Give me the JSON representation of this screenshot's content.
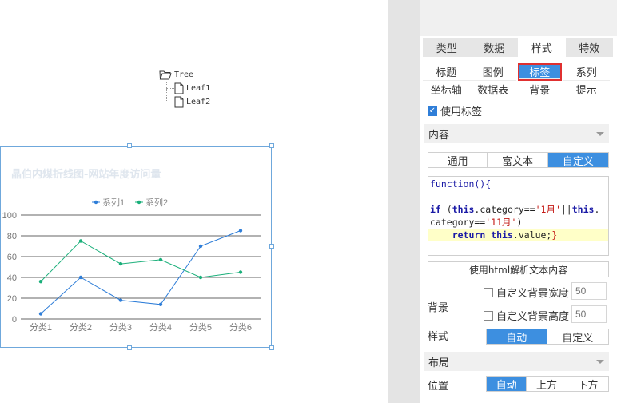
{
  "tree": {
    "root": "Tree",
    "leaves": [
      "Leaf1",
      "Leaf2"
    ]
  },
  "chart_data": {
    "type": "line",
    "title": "晶伯内煤折线图-网站年度访问量",
    "categories": [
      "分类1",
      "分类2",
      "分类3",
      "分类4",
      "分类5",
      "分类6"
    ],
    "series": [
      {
        "name": "系列1",
        "values": [
          5,
          40,
          18,
          14,
          70,
          85
        ],
        "color": "#2f7ed8"
      },
      {
        "name": "系列2",
        "values": [
          36,
          75,
          53,
          57,
          40,
          45
        ],
        "color": "#1aaf7a"
      }
    ],
    "y_ticks": [
      "0",
      "20",
      "40",
      "60",
      "80",
      "100"
    ],
    "ylim": [
      0,
      100
    ],
    "grid": true,
    "legend": "top-center"
  },
  "panel": {
    "main_tabs": [
      {
        "label": "类型",
        "active": false
      },
      {
        "label": "数据",
        "active": false
      },
      {
        "label": "样式",
        "active": true
      },
      {
        "label": "特效",
        "active": false
      }
    ],
    "sub_tabs": [
      {
        "label": "标题",
        "active": false
      },
      {
        "label": "图例",
        "active": false
      },
      {
        "label": "标签",
        "active": true
      },
      {
        "label": "系列",
        "active": false
      },
      {
        "label": "坐标轴",
        "active": false
      },
      {
        "label": "数据表",
        "active": false
      },
      {
        "label": "背景",
        "active": false
      },
      {
        "label": "提示",
        "active": false
      }
    ],
    "use_label": {
      "label": "使用标签",
      "checked": true
    },
    "content_section": "内容",
    "content_modes": [
      "通用",
      "富文本",
      "自定义"
    ],
    "content_mode_active": 2,
    "code": {
      "line1": "function(){",
      "line3_kw1": "if",
      "line3_a": " (",
      "line3_this1": "this",
      "line3_b": ".category==",
      "line3_str1": "'1月'",
      "line3_c": "||",
      "line3_this2": "this",
      "line3_d": ".",
      "line4_a": "category==",
      "line4_str2": "'11月'",
      "line4_b": ")",
      "line5_kw": "return",
      "line5_this": "this",
      "line5_rest": ".value;",
      "line5_brace": "}"
    },
    "html_parse_button": "使用html解析文本内容",
    "background_label": "背景",
    "custom_bg_width": {
      "label": "自定义背景宽度",
      "checked": false,
      "placeholder": "50"
    },
    "custom_bg_height": {
      "label": "自定义背景高度",
      "checked": false,
      "placeholder": "50"
    },
    "style_label": "样式",
    "style_modes": [
      "自动",
      "自定义"
    ],
    "style_mode_active": 0,
    "layout_section": "布局",
    "position_label": "位置",
    "position_modes": [
      "自动",
      "上方",
      "下方"
    ],
    "position_mode_active": 0
  }
}
